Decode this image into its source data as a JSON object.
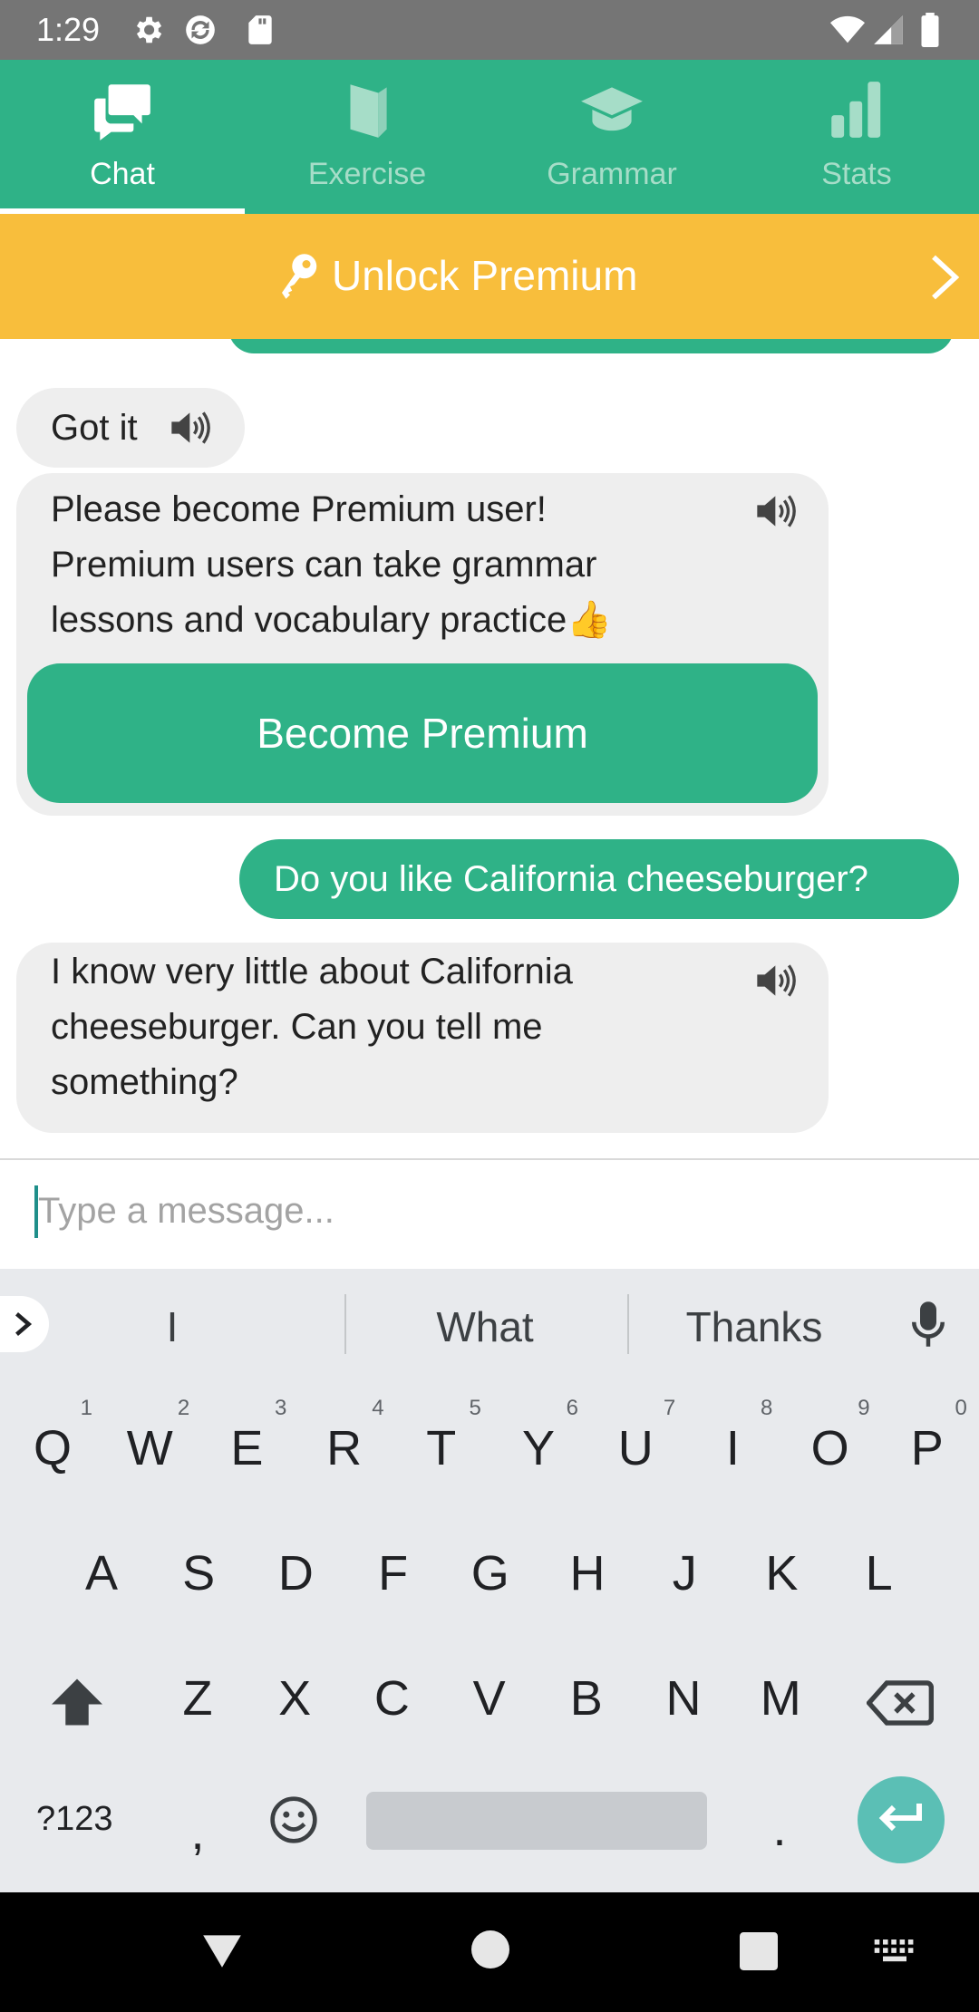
{
  "status_bar": {
    "time": "1:29",
    "icons": [
      "settings-icon",
      "sync-icon",
      "sd-card-icon",
      "wifi-icon",
      "signal-icon",
      "battery-icon"
    ]
  },
  "tabs": [
    {
      "label": "Chat",
      "icon": "chat-bubbles-icon",
      "active": true
    },
    {
      "label": "Exercise",
      "icon": "book-icon",
      "active": false
    },
    {
      "label": "Grammar",
      "icon": "graduation-cap-icon",
      "active": false
    },
    {
      "label": "Stats",
      "icon": "bar-chart-icon",
      "active": false
    }
  ],
  "banner": {
    "text": "Unlock Premium",
    "icon": "key-icon"
  },
  "messages": [
    {
      "from": "bot",
      "text": "Got it"
    },
    {
      "from": "bot",
      "lines": [
        "Please become Premium user!",
        "Premium users can take grammar",
        "lessons and vocabulary practice👍"
      ],
      "button": "Become Premium"
    },
    {
      "from": "user",
      "text": "Do you like California cheeseburger?"
    },
    {
      "from": "bot",
      "lines": [
        "I know very little about California",
        "cheeseburger. Can you tell me",
        "something?"
      ]
    }
  ],
  "composer": {
    "placeholder": "Type a message...",
    "value": ""
  },
  "keyboard": {
    "suggestions": [
      "I",
      "What",
      "Thanks"
    ],
    "row1": [
      "Q",
      "W",
      "E",
      "R",
      "T",
      "Y",
      "U",
      "I",
      "O",
      "P"
    ],
    "row1_hints": [
      "1",
      "2",
      "3",
      "4",
      "5",
      "6",
      "7",
      "8",
      "9",
      "0"
    ],
    "row2": [
      "A",
      "S",
      "D",
      "F",
      "G",
      "H",
      "J",
      "K",
      "L"
    ],
    "row3": [
      "Z",
      "X",
      "C",
      "V",
      "B",
      "N",
      "M"
    ],
    "symbols_key": "?123",
    "comma": ",",
    "period": "."
  },
  "colors": {
    "brand_green": "#2fb287",
    "banner_yellow": "#f8be3c",
    "bot_bubble": "#eeeeee",
    "enter_key": "#5bbfb5"
  }
}
